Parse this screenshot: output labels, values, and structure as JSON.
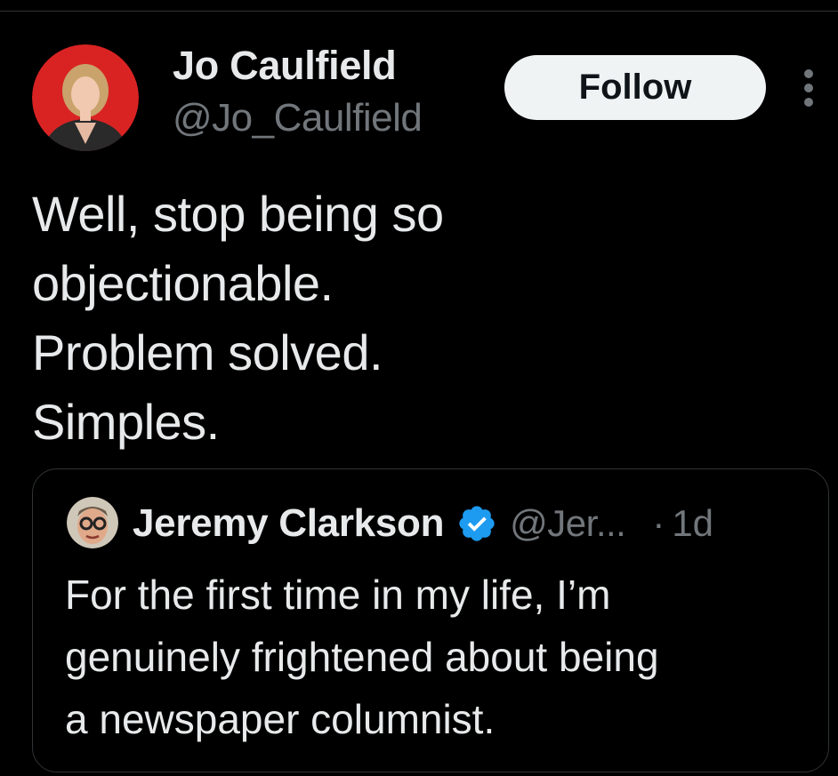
{
  "tweet": {
    "author": {
      "display_name": "Jo Caulfield",
      "handle": "@Jo_Caulfield",
      "avatar_icon": "profile-photo-avatar"
    },
    "follow_label": "Follow",
    "more_icon": "more-options-vertical-icon",
    "text_lines": [
      "Well, stop being so",
      "objectionable.",
      "Problem solved.",
      "Simples."
    ]
  },
  "quoted_tweet": {
    "author": {
      "display_name": "Jeremy Clarkson",
      "handle": "@Jer...",
      "verified": true,
      "verified_icon": "verified-badge-icon",
      "avatar_icon": "profile-photo-avatar"
    },
    "separator": "·",
    "time": "1d",
    "text_lines": [
      "For the first time in my life, I’m",
      "genuinely frightened about being",
      "a newspaper columnist."
    ]
  },
  "colors": {
    "background": "#000000",
    "primary_text": "#e7e9ea",
    "secondary_text": "#71767b",
    "border": "#2f3336",
    "follow_button_bg": "#eff3f4",
    "follow_button_text": "#0f1419",
    "verified_blue": "#1d9bf0",
    "avatar_red": "#d92323"
  }
}
